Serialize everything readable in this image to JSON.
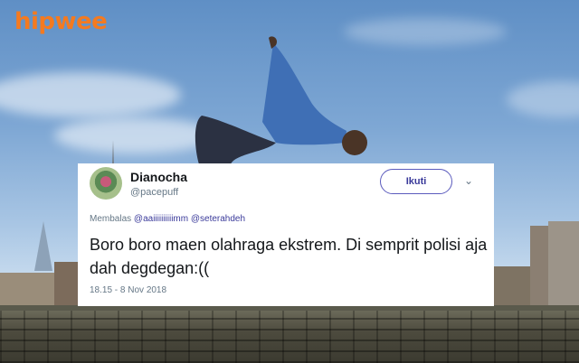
{
  "brand": {
    "logo_text": "hipwee",
    "logo_color": "#f47a20"
  },
  "tweet": {
    "display_name": "Dianocha",
    "handle": "@pacepuff",
    "follow_label": "Ikuti",
    "reply_prefix": "Membalas",
    "reply_to": [
      "@aaiiiiiiiiiimm",
      "@seterahdeh"
    ],
    "text": "Boro boro maen olahraga ekstrem. Di semprit polisi aja dah degdegan:((",
    "timestamp": "18.15 - 8 Nov 2018"
  },
  "icons": {
    "more": "chevron-down-icon",
    "avatar": "avatar-image"
  },
  "colors": {
    "accent": "#3a3a9a",
    "secondary_text": "#657786"
  }
}
